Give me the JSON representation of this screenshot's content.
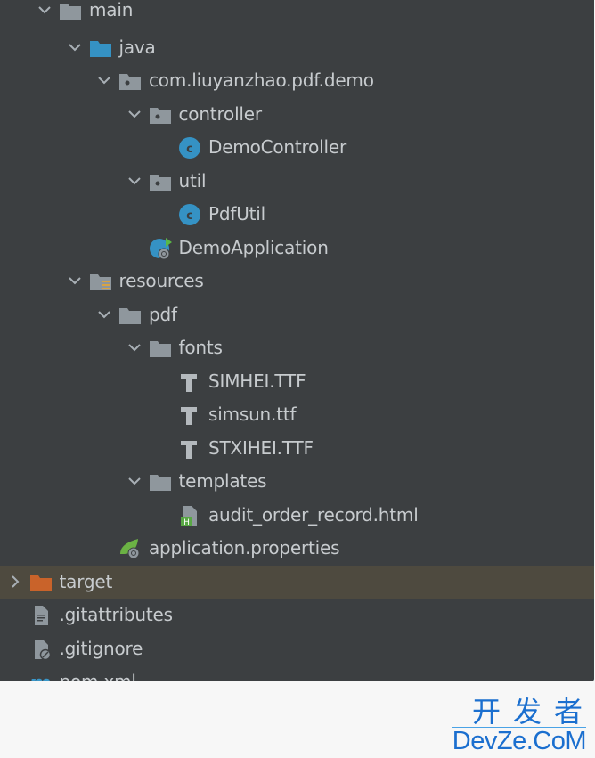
{
  "tree": {
    "rows": [
      {
        "label": "main",
        "level": 2,
        "expanded": true,
        "icon": "folder-icon",
        "row": -0.1
      },
      {
        "label": "java",
        "level": 3,
        "expanded": true,
        "icon": "source-folder-icon"
      },
      {
        "label": "com.liuyanzhao.pdf.demo",
        "level": 4,
        "expanded": true,
        "icon": "package-icon"
      },
      {
        "label": "controller",
        "level": 5,
        "expanded": true,
        "icon": "package-icon"
      },
      {
        "label": "DemoController",
        "level": 6,
        "icon": "java-class-icon"
      },
      {
        "label": "util",
        "level": 5,
        "expanded": true,
        "icon": "package-icon"
      },
      {
        "label": "PdfUtil",
        "level": 6,
        "icon": "java-class-icon"
      },
      {
        "label": "DemoApplication",
        "level": 5,
        "icon": "spring-boot-app-icon"
      },
      {
        "label": "resources",
        "level": 3,
        "expanded": true,
        "icon": "resources-folder-icon"
      },
      {
        "label": "pdf",
        "level": 4,
        "expanded": true,
        "icon": "folder-icon"
      },
      {
        "label": "fonts",
        "level": 5,
        "expanded": true,
        "icon": "folder-icon"
      },
      {
        "label": "SIMHEI.TTF",
        "level": 6,
        "icon": "font-file-icon"
      },
      {
        "label": "simsun.ttf",
        "level": 6,
        "icon": "font-file-icon"
      },
      {
        "label": "STXIHEI.TTF",
        "level": 6,
        "icon": "font-file-icon"
      },
      {
        "label": "templates",
        "level": 5,
        "expanded": true,
        "icon": "folder-icon"
      },
      {
        "label": "audit_order_record.html",
        "level": 6,
        "icon": "html-file-icon"
      },
      {
        "label": "application.properties",
        "level": 4,
        "icon": "spring-properties-icon"
      },
      {
        "label": "target",
        "level": 1,
        "expanded": false,
        "icon": "excluded-folder-icon",
        "selected": true
      },
      {
        "label": ".gitattributes",
        "level": 1,
        "icon": "text-file-icon"
      },
      {
        "label": ".gitignore",
        "level": 1,
        "icon": "ignored-file-icon"
      },
      {
        "label": "pom.xml",
        "level": 1,
        "icon": "maven-icon"
      }
    ]
  },
  "colors": {
    "background": "#3c3f41",
    "selected_row": "#4e4a3f",
    "text": "#c7cbce",
    "folder": "#8f979d",
    "source_folder": "#3592c4",
    "excluded_folder": "#c9632a",
    "class": "#3592c4",
    "spring": "#6bb244"
  },
  "watermark": {
    "chinese": "开发者",
    "latin": "DevZe.CoM"
  }
}
